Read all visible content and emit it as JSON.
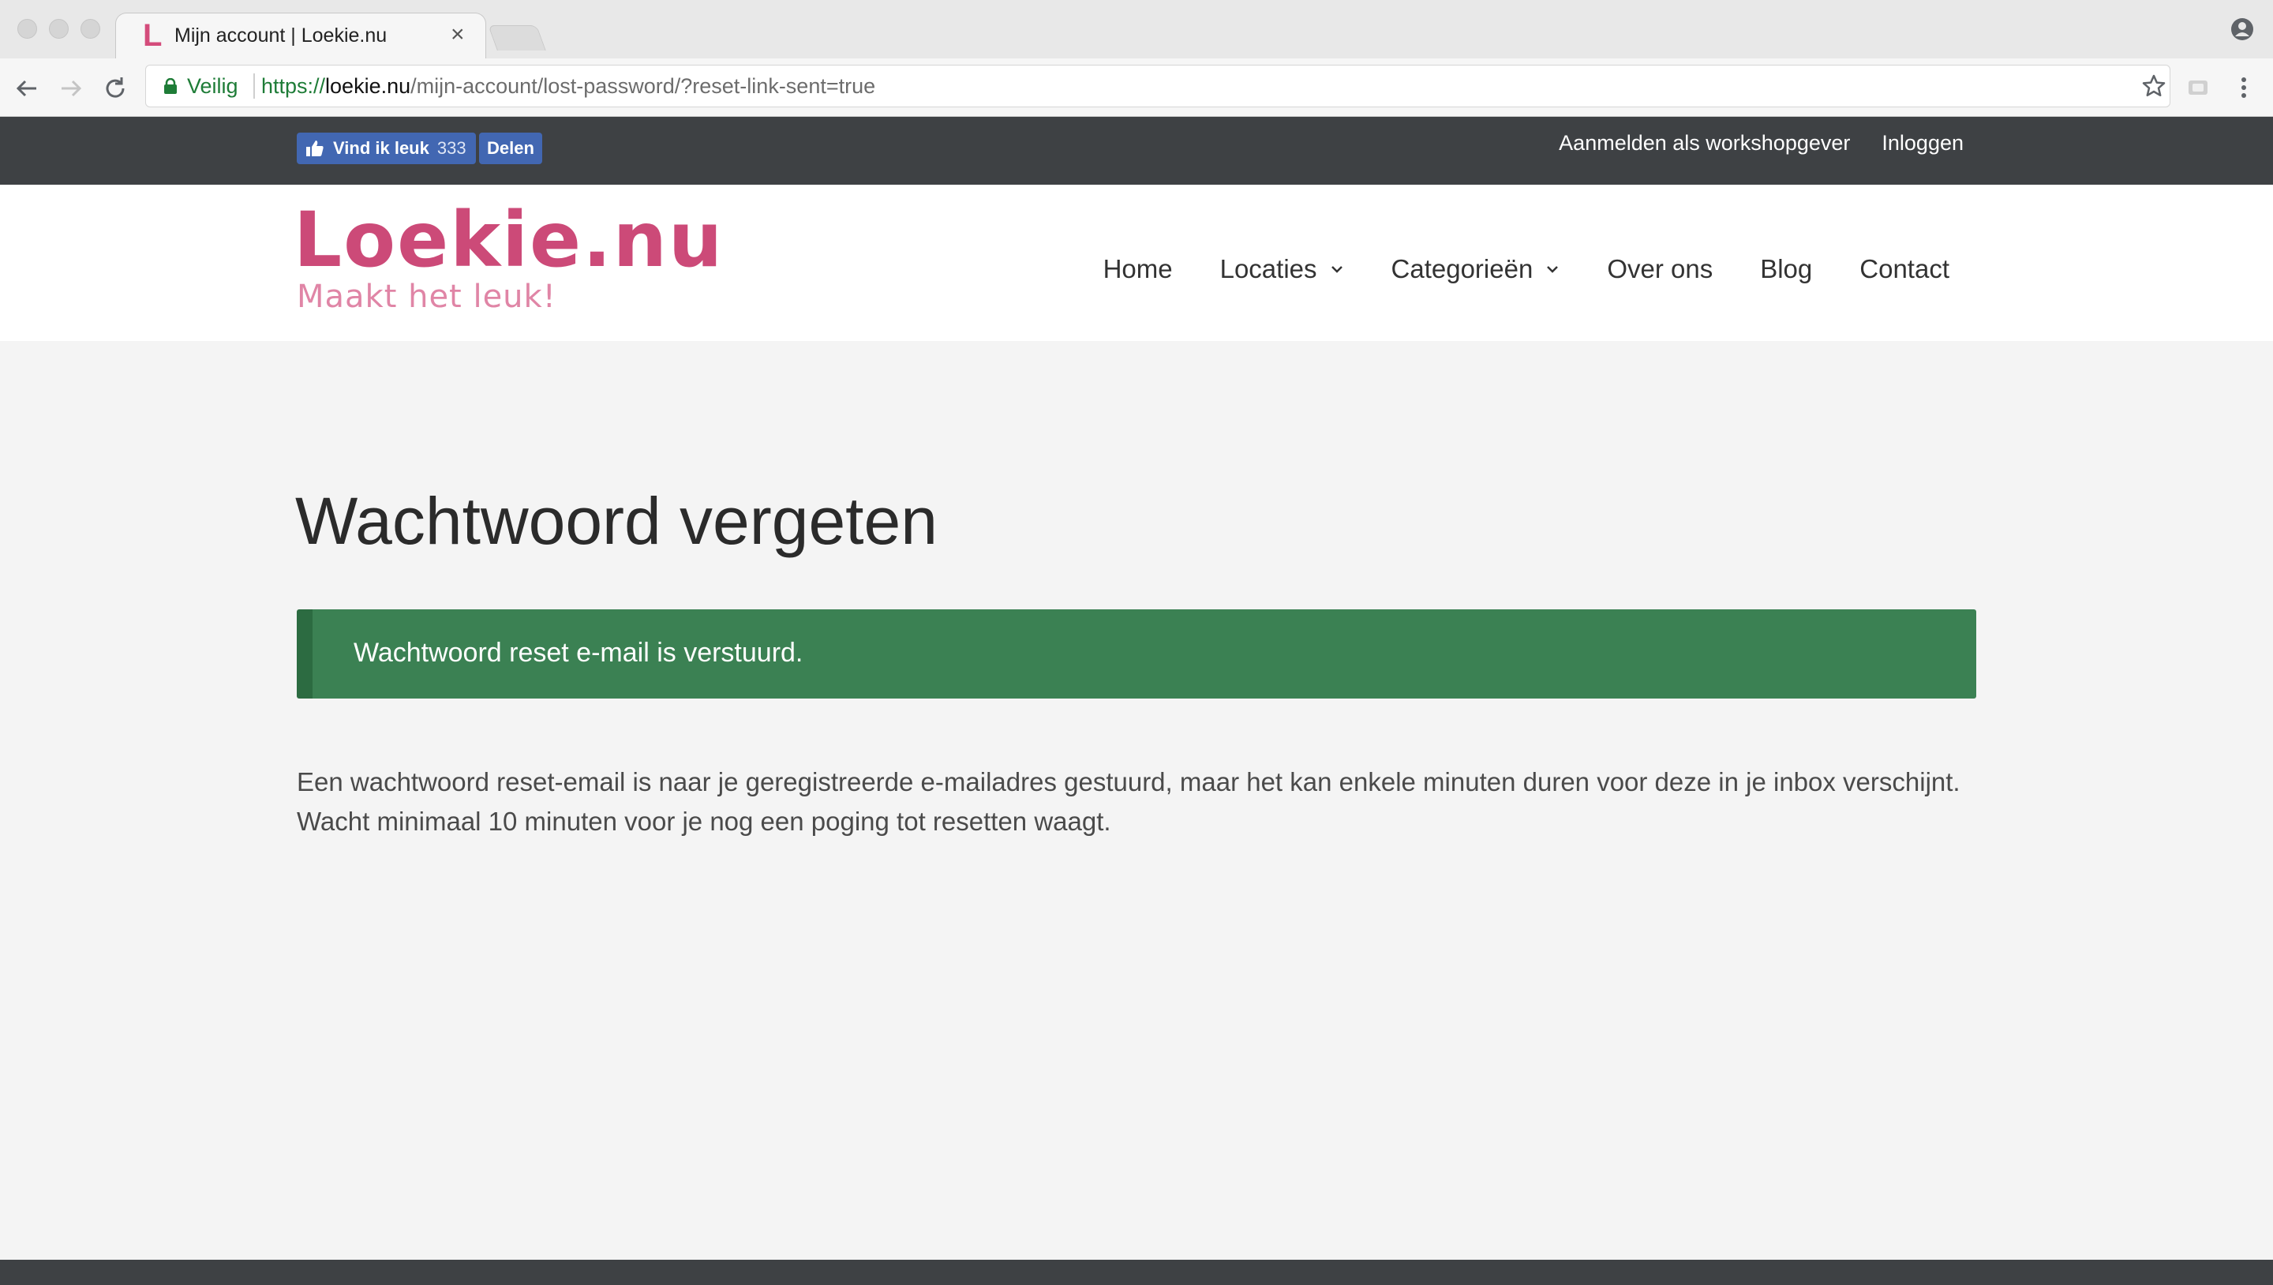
{
  "browser": {
    "tab_title": "Mijn account | Loekie.nu",
    "tab_favicon": "L",
    "tab_close": "×",
    "secure_label": "Veilig",
    "url_scheme": "https://",
    "url_host": "loekie.nu",
    "url_path": "/mijn-account/lost-password/?reset-link-sent=true"
  },
  "facebook": {
    "like_label": "Vind ik leuk",
    "like_count": "333",
    "share_label": "Delen"
  },
  "topbar": {
    "register_link": "Aanmelden als workshopgever",
    "login_link": "Inloggen"
  },
  "logo": {
    "name": "Loekie.nu",
    "tagline": "Maakt het leuk!"
  },
  "nav": {
    "home": "Home",
    "locaties": "Locaties",
    "categorieen": "Categorieën",
    "over_ons": "Over ons",
    "blog": "Blog",
    "contact": "Contact"
  },
  "content": {
    "title": "Wachtwoord vergeten",
    "notice": "Wachtwoord reset e-mail is verstuurd.",
    "body": "Een wachtwoord reset-email is naar je geregistreerde e-mailadres gestuurd, maar het kan enkele minuten duren voor deze in je inbox verschijnt. Wacht minimaal 10 minuten voor je nog een poging tot resetten waagt."
  },
  "colors": {
    "brand_pink": "#cc4a78",
    "topbar_bg": "#3e4144",
    "success_green": "#3b8153",
    "facebook_blue": "#4267b2"
  },
  "icons": [
    "lock-icon",
    "star-icon",
    "back-arrow-icon",
    "forward-arrow-icon",
    "reload-icon",
    "profile-icon",
    "menu-icon",
    "thumbs-up-icon",
    "chevron-down-icon"
  ]
}
